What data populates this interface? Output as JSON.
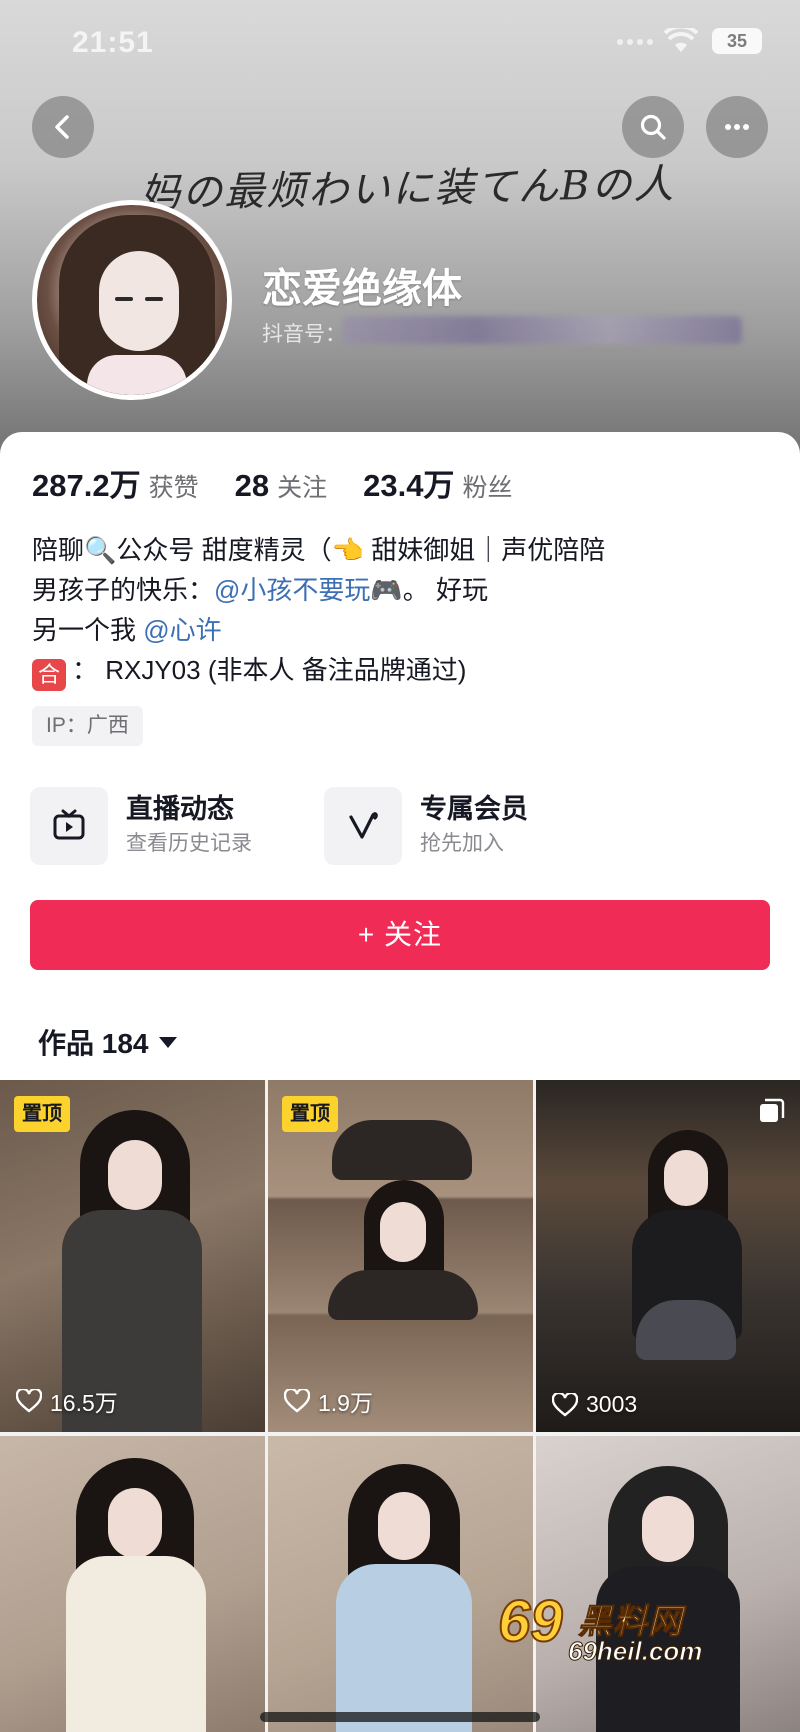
{
  "status_bar": {
    "time": "21:51",
    "battery": "35"
  },
  "banner": {
    "title": "妈の最烦わいに装てんBの人"
  },
  "profile": {
    "nickname": "恋爱绝缘体",
    "douyin_id_label": "抖音号："
  },
  "stats": [
    {
      "value": "287.2万",
      "label": "获赞"
    },
    {
      "value": "28",
      "label": "关注"
    },
    {
      "value": "23.4万",
      "label": "粉丝"
    }
  ],
  "bio": {
    "line1": {
      "text": "陪聊🔍公众号  甜度精灵（👈 甜妹御姐｜声优陪陪"
    },
    "line2": {
      "prefix": "男孩子的快乐：",
      "mention": "@小孩不要玩🎮",
      "suffix": "。 好玩"
    },
    "line3": {
      "prefix": "另一个我",
      "mention": "@心许"
    },
    "line4": {
      "tag": "合",
      "text": "： RXJY03 (非本人 备注品牌通过)"
    }
  },
  "ip_location": "IP：广西",
  "entries": [
    {
      "title": "直播动态",
      "subtitle": "查看历史记录",
      "icon": "tv-icon"
    },
    {
      "title": "专属会员",
      "subtitle": "抢先加入",
      "icon": "v-icon"
    }
  ],
  "follow_button": "+ 关注",
  "works_tab": {
    "label": "作品 184"
  },
  "videos": [
    {
      "pinned": "置顶",
      "likes": "16.5万"
    },
    {
      "pinned": "置顶",
      "likes": "1.9万"
    },
    {
      "likes": "3003"
    },
    {},
    {},
    {}
  ],
  "watermark": {
    "number": "69",
    "brand": "黑料网",
    "url": "69heil.com"
  },
  "colors": {
    "accent": "#f02b56",
    "mention": "#3d6fb5",
    "pin_badge": "#fcd22c"
  }
}
